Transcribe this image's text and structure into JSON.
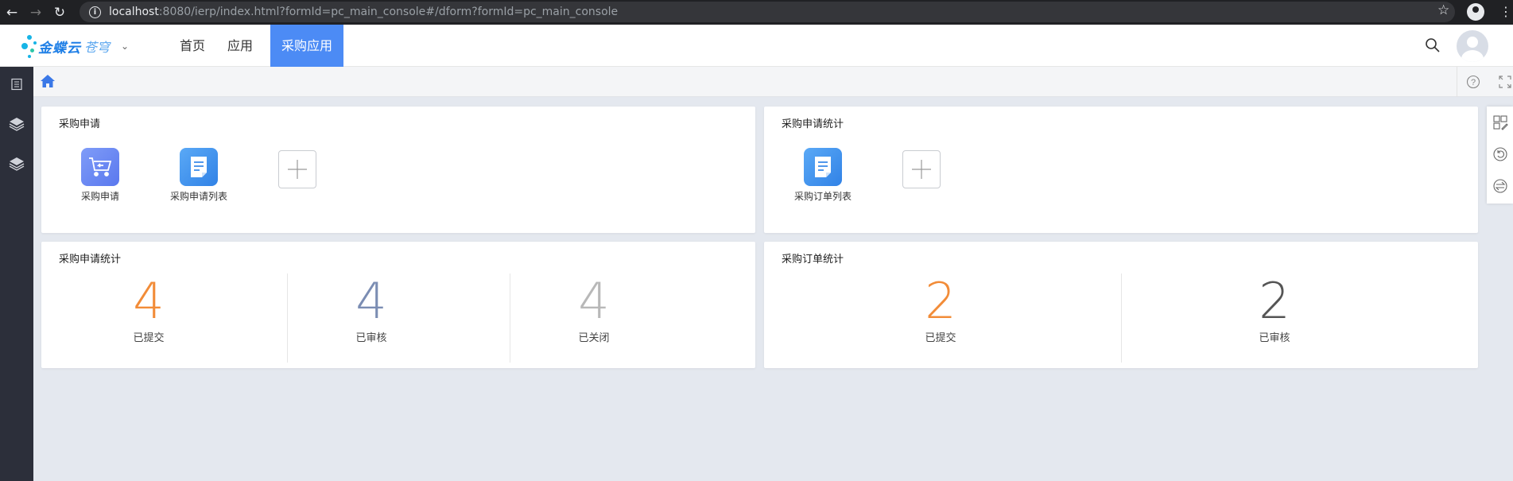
{
  "browser": {
    "url_host": "localhost",
    "url_rest": ":8080/ierp/index.html?formId=pc_main_console#/dform?formId=pc_main_console"
  },
  "header": {
    "brand": "金蝶云",
    "brand_sub": "苍穹",
    "tabs": [
      {
        "label": "首页"
      },
      {
        "label": "应用"
      },
      {
        "label": "采购应用"
      }
    ],
    "accent": "#4c8bf5"
  },
  "cards": {
    "purchase_request": {
      "title": "采购申请",
      "apps": [
        {
          "label": "采购申请",
          "icon": "shopping-cart-icon"
        },
        {
          "label": "采购申请列表",
          "icon": "document-list-icon"
        }
      ]
    },
    "purchase_request_stats_top": {
      "title": "采购申请统计",
      "apps": [
        {
          "label": "采购订单列表",
          "icon": "document-list-icon"
        }
      ]
    },
    "purchase_request_stats": {
      "title": "采购申请统计",
      "stats": [
        {
          "value": "4",
          "label": "已提交",
          "color": "#f28c38"
        },
        {
          "value": "4",
          "label": "已审核",
          "color": "#7b8db3"
        },
        {
          "value": "4",
          "label": "已关闭",
          "color": "#b8b8b8"
        }
      ]
    },
    "purchase_order_stats": {
      "title": "采购订单统计",
      "stats": [
        {
          "value": "2",
          "label": "已提交",
          "color": "#f28c38"
        },
        {
          "value": "2",
          "label": "已审核",
          "color": "#555555"
        }
      ]
    }
  }
}
